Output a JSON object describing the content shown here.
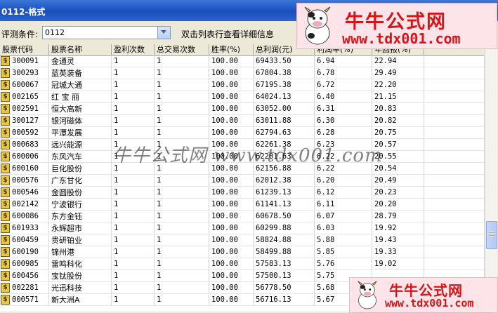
{
  "window": {
    "title": "0112-格式"
  },
  "condition": {
    "label": "评测条件:",
    "value": "0112",
    "hint": "双击列表行查看详细信息"
  },
  "columns": [
    "股票代码",
    "股票名称",
    "盈利次数",
    "总交易次数",
    "胜率(%)",
    "总利润(元)",
    "利润率(%)",
    "年回报(%)"
  ],
  "rows": [
    {
      "code": "300091",
      "name": "金通灵",
      "wins": "1",
      "trades": "1",
      "winrate": "100.00",
      "profit": "69433.50",
      "rate": "6.94",
      "annual": "22.94"
    },
    {
      "code": "300293",
      "name": "蓝英装备",
      "wins": "1",
      "trades": "1",
      "winrate": "100.00",
      "profit": "67804.38",
      "rate": "6.78",
      "annual": "29.49"
    },
    {
      "code": "600067",
      "name": "冠城大通",
      "wins": "1",
      "trades": "1",
      "winrate": "100.00",
      "profit": "67195.38",
      "rate": "6.72",
      "annual": "22.20"
    },
    {
      "code": "002165",
      "name": "红 宝 丽",
      "wins": "1",
      "trades": "1",
      "winrate": "100.00",
      "profit": "64024.13",
      "rate": "6.40",
      "annual": "21.15"
    },
    {
      "code": "002591",
      "name": "恒大高新",
      "wins": "1",
      "trades": "1",
      "winrate": "100.00",
      "profit": "63052.00",
      "rate": "6.31",
      "annual": "20.83"
    },
    {
      "code": "300127",
      "name": "银河磁体",
      "wins": "1",
      "trades": "1",
      "winrate": "100.00",
      "profit": "63011.88",
      "rate": "6.30",
      "annual": "20.82"
    },
    {
      "code": "000592",
      "name": "平潭发展",
      "wins": "1",
      "trades": "1",
      "winrate": "100.00",
      "profit": "62794.63",
      "rate": "6.28",
      "annual": "20.75"
    },
    {
      "code": "000683",
      "name": "远兴能源",
      "wins": "1",
      "trades": "1",
      "winrate": "100.00",
      "profit": "62261.38",
      "rate": "6.23",
      "annual": "20.57"
    },
    {
      "code": "600006",
      "name": "东风汽车",
      "wins": "1",
      "trades": "1",
      "winrate": "100.00",
      "profit": "62201.63",
      "rate": "6.22",
      "annual": "20.55"
    },
    {
      "code": "600160",
      "name": "巨化股份",
      "wins": "1",
      "trades": "1",
      "winrate": "100.00",
      "profit": "62156.88",
      "rate": "6.22",
      "annual": "20.54"
    },
    {
      "code": "000576",
      "name": "广东甘化",
      "wins": "1",
      "trades": "1",
      "winrate": "100.00",
      "profit": "62012.38",
      "rate": "6.20",
      "annual": "20.49"
    },
    {
      "code": "000546",
      "name": "金圆股份",
      "wins": "1",
      "trades": "1",
      "winrate": "100.00",
      "profit": "61239.13",
      "rate": "6.12",
      "annual": "20.23"
    },
    {
      "code": "002142",
      "name": "宁波银行",
      "wins": "1",
      "trades": "1",
      "winrate": "100.00",
      "profit": "61141.13",
      "rate": "6.11",
      "annual": "20.20"
    },
    {
      "code": "600086",
      "name": "东方金钰",
      "wins": "1",
      "trades": "1",
      "winrate": "100.00",
      "profit": "60678.50",
      "rate": "6.07",
      "annual": "28.79"
    },
    {
      "code": "601933",
      "name": "永辉超市",
      "wins": "1",
      "trades": "1",
      "winrate": "100.00",
      "profit": "60299.88",
      "rate": "6.03",
      "annual": "19.92"
    },
    {
      "code": "600459",
      "name": "贵研铂业",
      "wins": "1",
      "trades": "1",
      "winrate": "100.00",
      "profit": "58824.88",
      "rate": "5.88",
      "annual": "19.43"
    },
    {
      "code": "600190",
      "name": "锦州港",
      "wins": "1",
      "trades": "1",
      "winrate": "100.00",
      "profit": "58499.88",
      "rate": "5.85",
      "annual": "19.33"
    },
    {
      "code": "600985",
      "name": "雷鸣科化",
      "wins": "1",
      "trades": "1",
      "winrate": "100.00",
      "profit": "57583.13",
      "rate": "5.76",
      "annual": "19.02"
    },
    {
      "code": "600456",
      "name": "宝钛股份",
      "wins": "1",
      "trades": "1",
      "winrate": "100.00",
      "profit": "57500.13",
      "rate": "5.75",
      "annual": ""
    },
    {
      "code": "002281",
      "name": "光迅科技",
      "wins": "1",
      "trades": "1",
      "winrate": "100.00",
      "profit": "56778.50",
      "rate": "5.68",
      "annual": ""
    },
    {
      "code": "000571",
      "name": "新大洲A",
      "wins": "1",
      "trades": "1",
      "winrate": "100.00",
      "profit": "56716.13",
      "rate": "5.67",
      "annual": ""
    }
  ],
  "watermark": {
    "top_cn": "牛牛公式网",
    "top_url": "www.tdx001.com",
    "mid": "牛牛公式网 www.tdx001.com",
    "bottom_cn": "牛牛公式网",
    "bottom_url": "www.tdx001.com"
  },
  "icons": {
    "row": "dollar-coin-icon"
  },
  "colors": {
    "watermark_red": "#d81418",
    "titlebar": "#1e55c4"
  }
}
